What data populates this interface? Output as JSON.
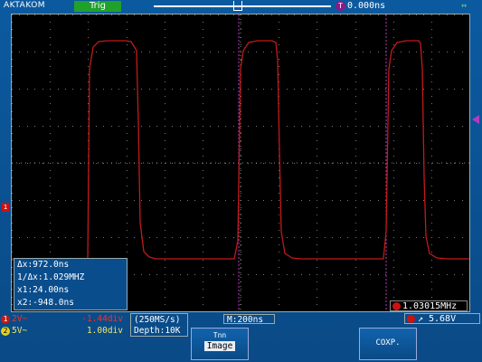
{
  "header": {
    "brand": "AKTAKOM",
    "status": "Trig",
    "trigger_channel_badge": "T",
    "trigger_time": "0.000ns",
    "usb_icon": "usb-icon"
  },
  "colors": {
    "ch1": "#c11a1a",
    "ch2": "#e0d21a",
    "status": "#1fa12a",
    "trigger_marker": "#b43bc0"
  },
  "side_markers": {
    "left_label": "1"
  },
  "cursor_readout": {
    "delta_x": "Δx:972.0ns",
    "inv_delta_x": "1/Δx:1.029MHZ",
    "x1": "x1:24.00ns",
    "x2": "x2:-948.0ns"
  },
  "frequency_readout": "1.03015MHz",
  "channels": [
    {
      "badge": "1",
      "label": "2V~",
      "value": "-1.44div"
    },
    {
      "badge": "2",
      "label": "5V~",
      "value": "1.00div"
    }
  ],
  "acquisition": {
    "sample_rate": "(250MS/s)",
    "depth": "Depth:10K"
  },
  "timebase": "M:200ns",
  "trigger": {
    "symbol": "↗",
    "level": "5.68V"
  },
  "softkeys": [
    {
      "line1": "Tnn",
      "line2": "Image"
    },
    {
      "line1": "COXP."
    }
  ]
}
